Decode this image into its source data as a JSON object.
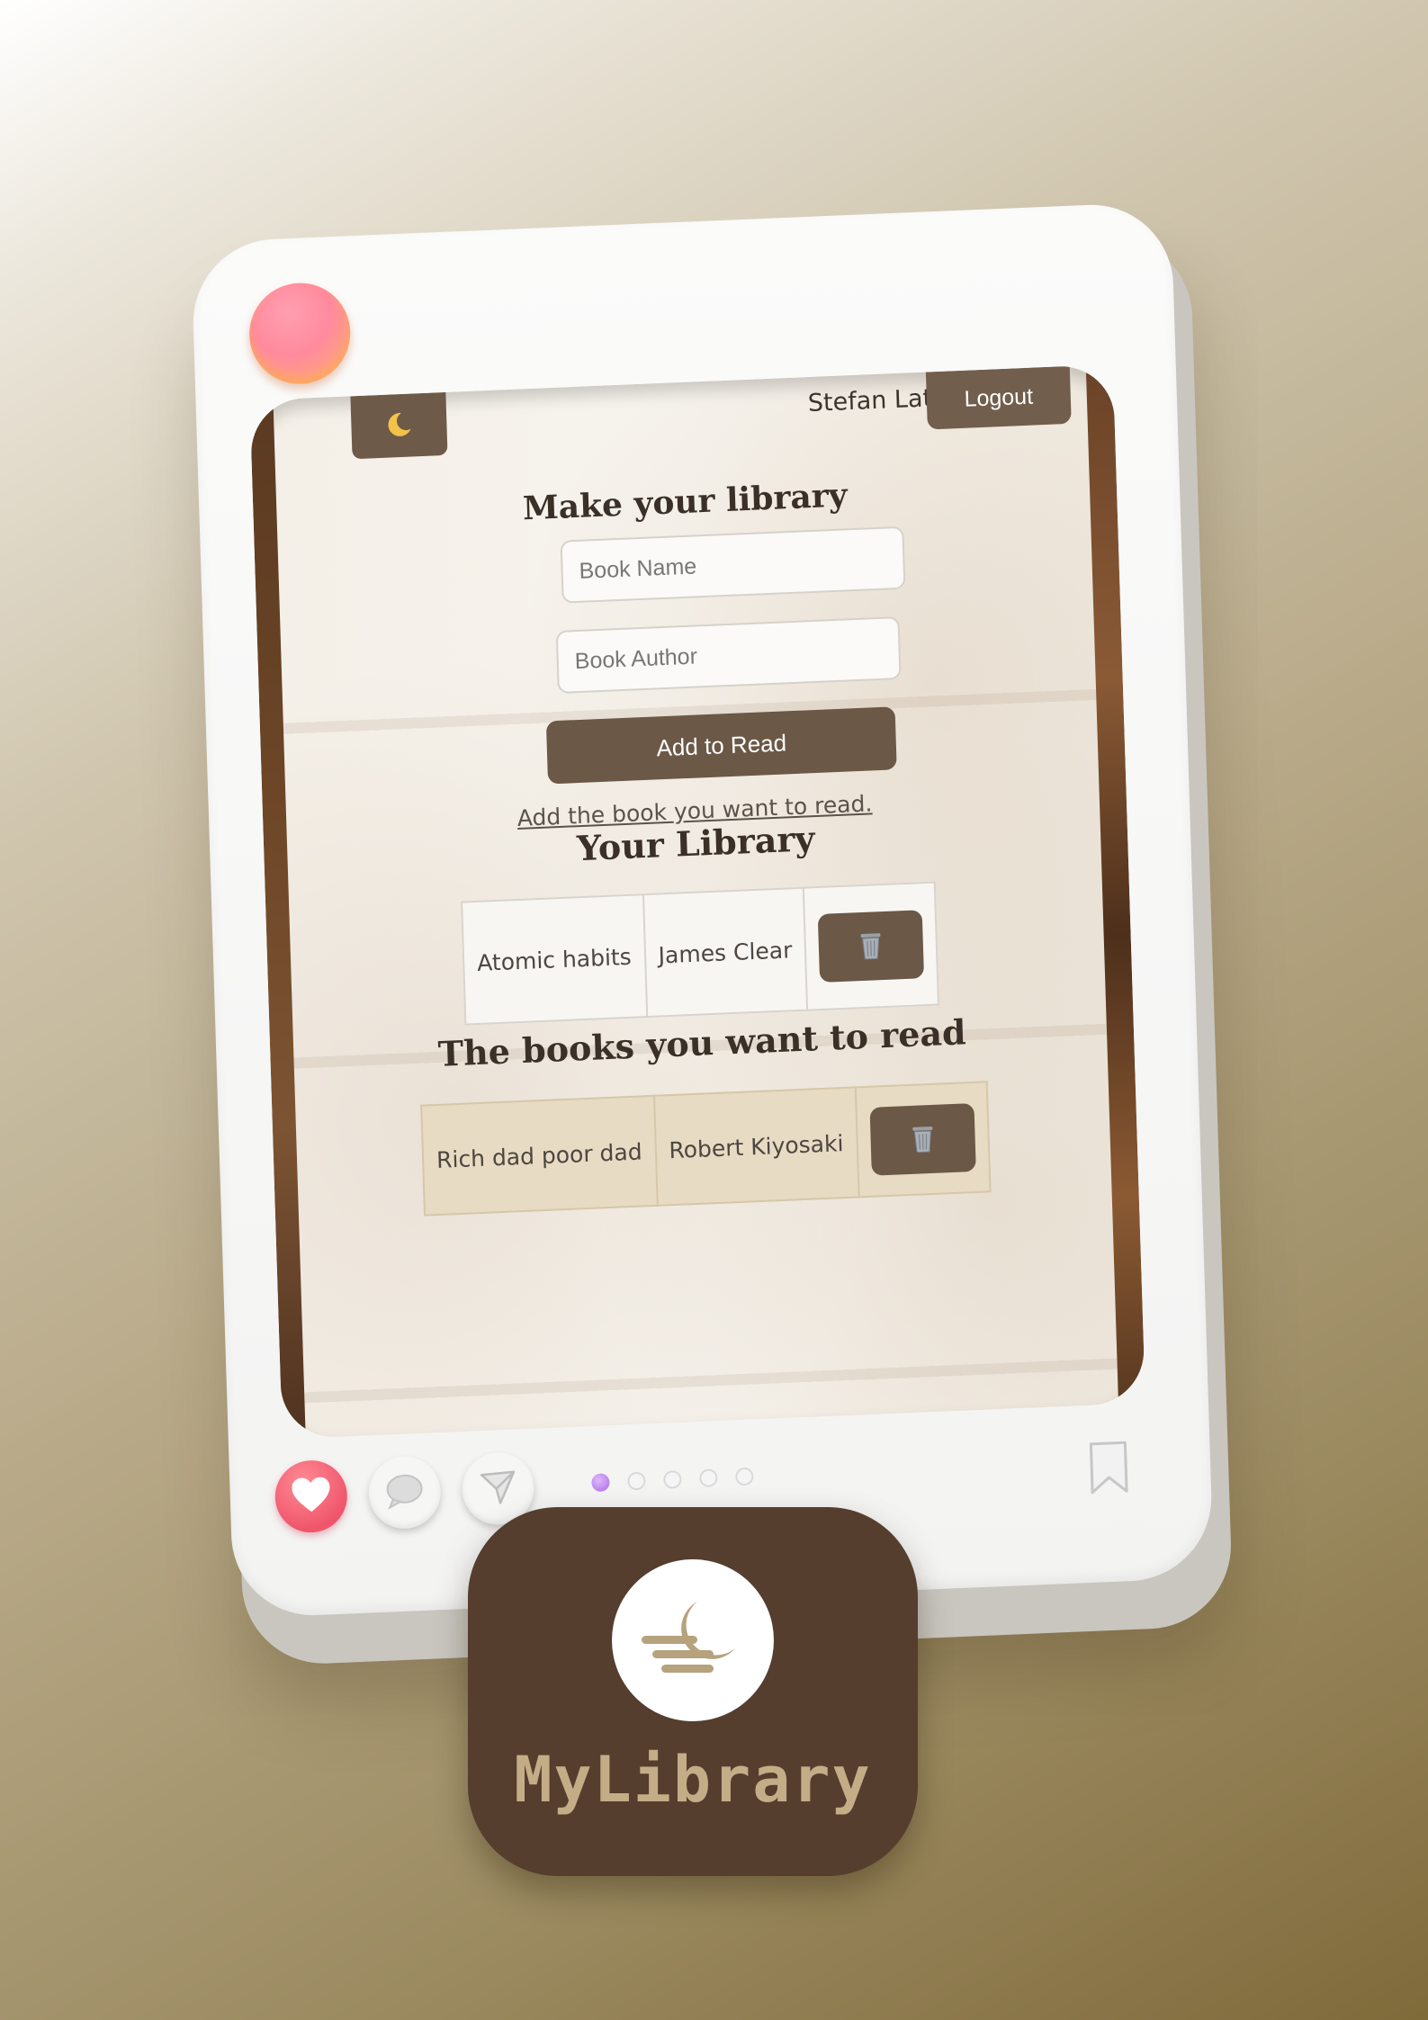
{
  "header": {
    "theme_toggle_icon": "moon-icon",
    "user_name": "Stefan Latic",
    "logout_label": "Logout"
  },
  "form": {
    "title": "Make your library",
    "book_name_placeholder": "Book Name",
    "book_author_placeholder": "Book Author",
    "add_button_label": "Add to Read",
    "hint_link": "Add the book you want to read."
  },
  "library": {
    "title": "Your Library",
    "rows": [
      {
        "name": "Atomic habits",
        "author": "James Clear",
        "action_icon": "trash-icon"
      }
    ]
  },
  "want_to_read": {
    "title": "The books you want to read",
    "rows": [
      {
        "name": "Rich dad poor dad",
        "author": "Robert Kiyosaki",
        "action_icon": "trash-icon"
      }
    ]
  },
  "post_actions": {
    "icons": [
      "heart-icon",
      "comment-icon",
      "share-icon",
      "bookmark-icon"
    ],
    "pagination_count": 5,
    "pagination_active": 1
  },
  "brand": {
    "app_name": "MyLibrary",
    "logo_icon": "moon-cloud-icon",
    "colors": {
      "brown": "#553e2e",
      "button_brown": "#6b5846",
      "gold": "#c3ad87",
      "like_red": "#f0566b"
    }
  }
}
